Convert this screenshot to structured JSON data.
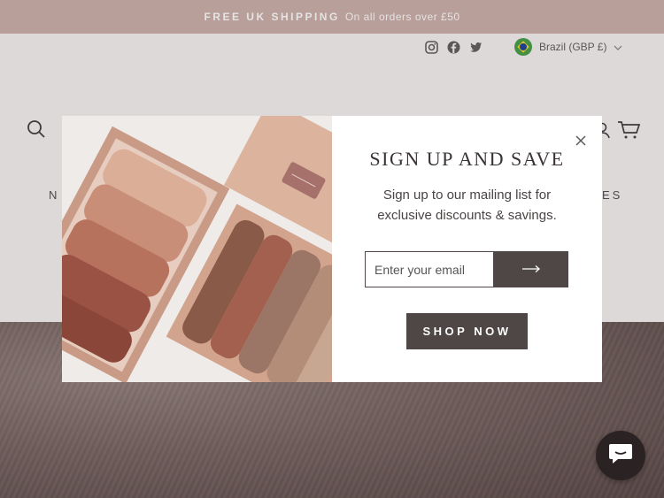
{
  "announcement": {
    "bold": "FREE UK SHIPPING",
    "text": "On all orders over £50"
  },
  "utility": {
    "social": [
      "instagram-icon",
      "facebook-icon",
      "twitter-icon"
    ],
    "currency": "Brazil (GBP £)"
  },
  "nav": {
    "partial_left": "N",
    "partial_right": "ES"
  },
  "popup": {
    "title": "SIGN UP AND SAVE",
    "subtitle": "Sign up to our mailing list for exclusive discounts & savings.",
    "email_placeholder": "Enter your email",
    "shop_label": "SHOP NOW"
  },
  "colors": {
    "announcement": "#c9aca7",
    "button": "#4f4646",
    "chat": "#2b2323"
  }
}
